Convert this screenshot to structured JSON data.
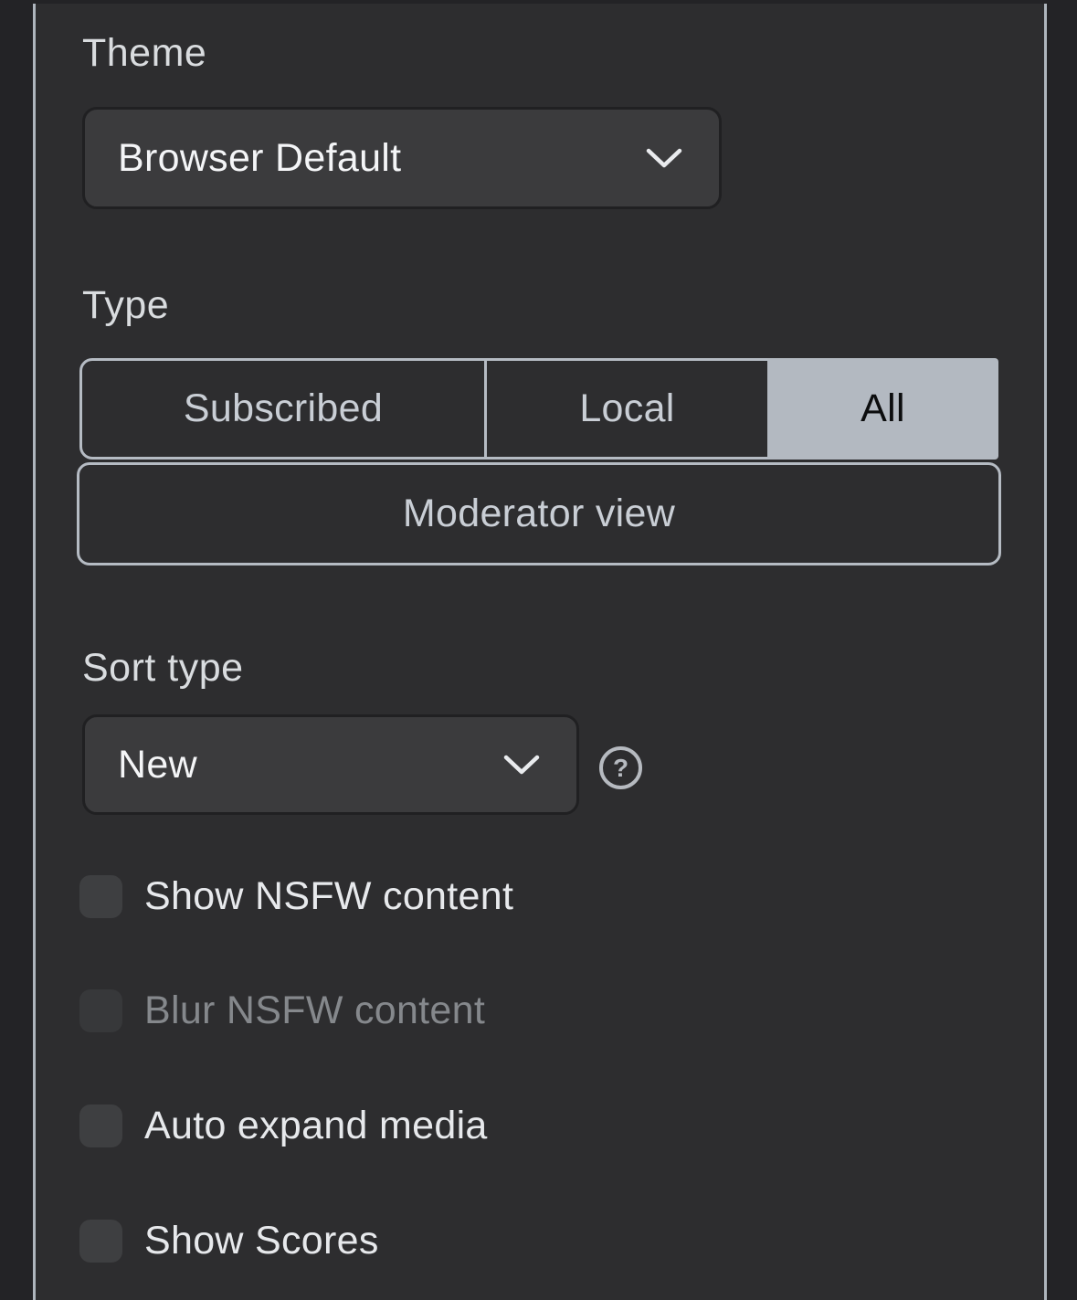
{
  "settings": {
    "theme": {
      "label": "Theme",
      "selected_value": "Browser Default"
    },
    "listing_type": {
      "label": "Type",
      "options": [
        {
          "label": "Subscribed",
          "selected": false
        },
        {
          "label": "Local",
          "selected": false
        },
        {
          "label": "All",
          "selected": true
        }
      ],
      "moderator_view_label": "Moderator view"
    },
    "sort": {
      "label": "Sort type",
      "selected_value": "New",
      "help_icon": "question-circle-icon"
    },
    "checkboxes": [
      {
        "label": "Show NSFW content",
        "checked": false,
        "disabled": false
      },
      {
        "label": "Blur NSFW content",
        "checked": false,
        "disabled": true
      },
      {
        "label": "Auto expand media",
        "checked": false,
        "disabled": false
      },
      {
        "label": "Show Scores",
        "checked": false,
        "disabled": false
      }
    ]
  },
  "colors": {
    "panel_background": "#2d2d2f",
    "outer_background": "#232326",
    "panel_border": "#aeb5bd",
    "segment_selected_background": "#b3b9c1",
    "segment_selected_text": "#0c0d0e",
    "control_background": "#3b3b3d",
    "text_primary": "#e7e9ec",
    "text_muted": "#85888c"
  }
}
